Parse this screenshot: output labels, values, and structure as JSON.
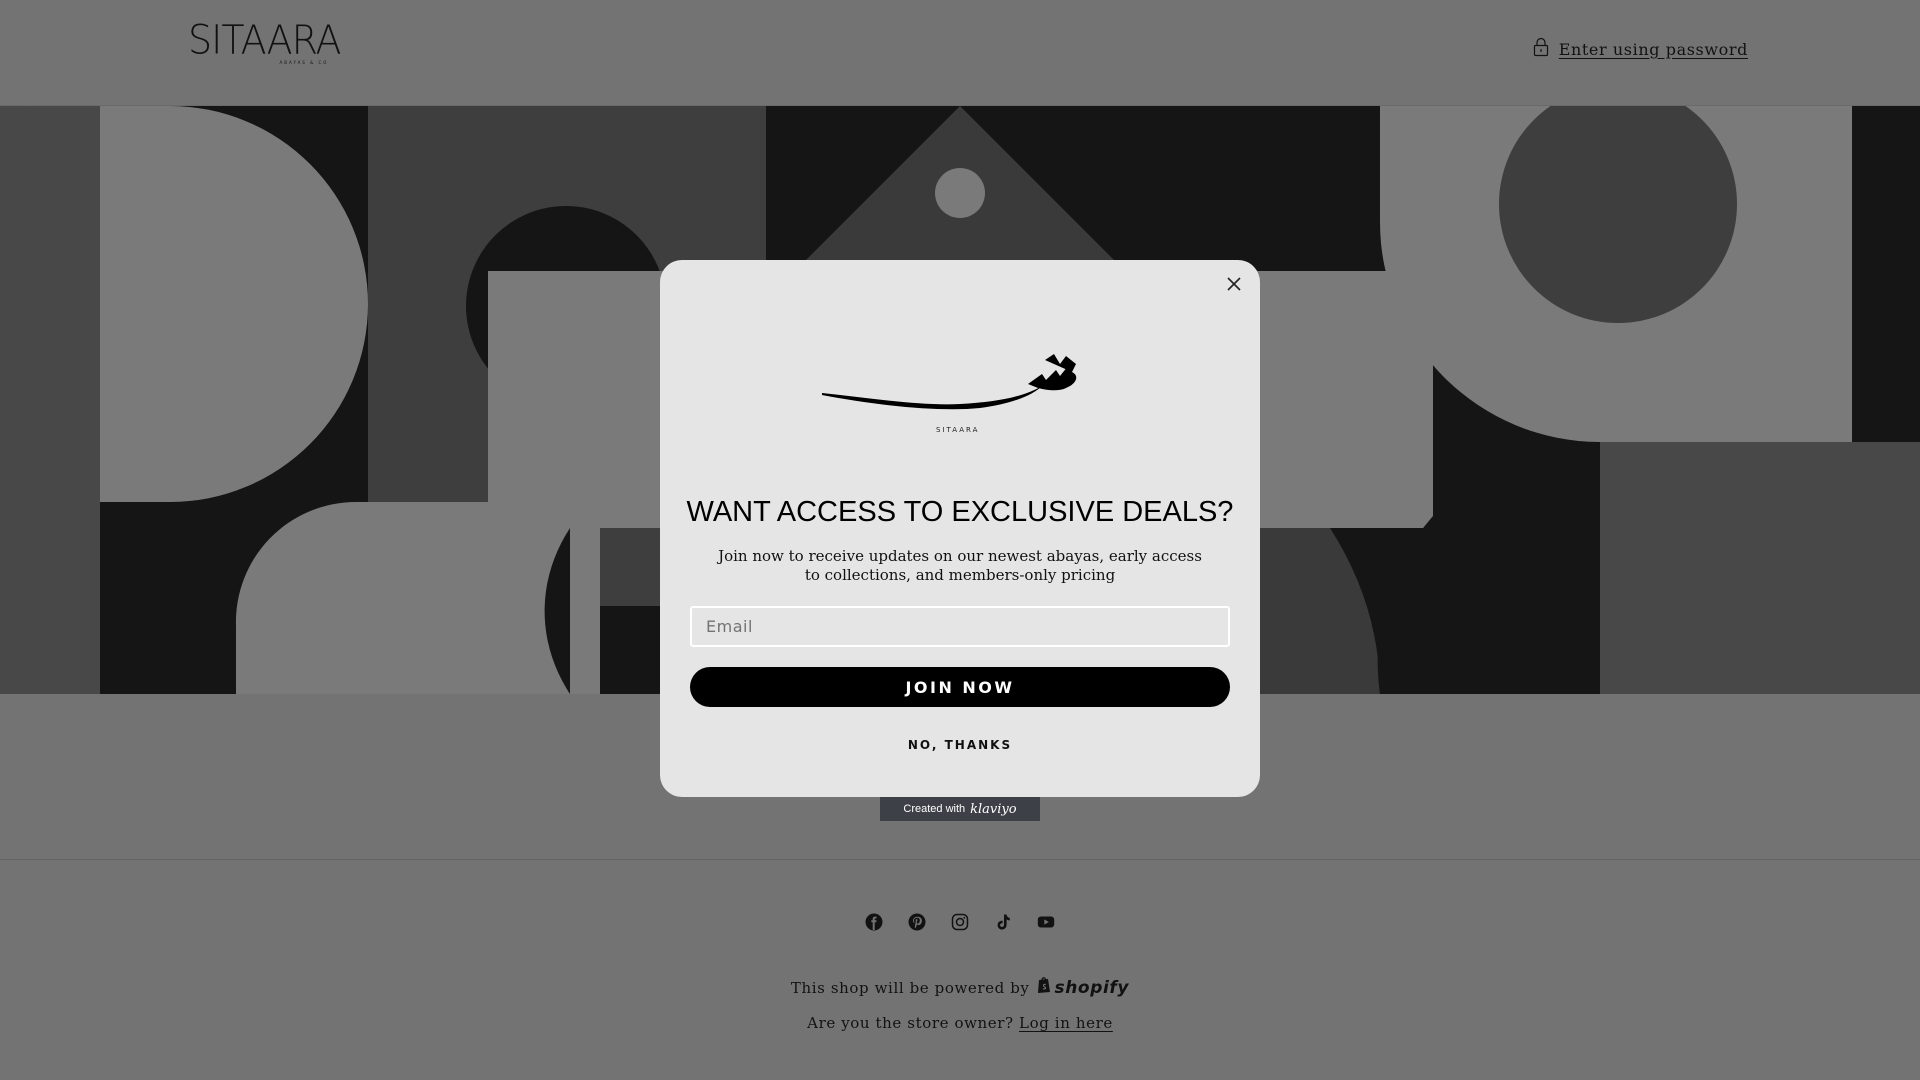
{
  "header": {
    "logo_text": "SITAARA",
    "logo_subtext": "ABAYAS & CO",
    "enter_password_label": "Enter using password"
  },
  "popup": {
    "brand_mark_text": "SITAARA",
    "heading": "WANT ACCESS TO EXCLUSIVE DEALS?",
    "subtext": "Join now to receive updates on our newest abayas, early access to collections, and members-only pricing",
    "email_placeholder": "Email",
    "email_value": "",
    "join_label": "JOIN NOW",
    "decline_label": "NO, THANKS",
    "close_icon": "close-icon"
  },
  "klaviyo_badge": {
    "prefix": "Created with",
    "brand": "klaviyo"
  },
  "footer": {
    "socials": [
      {
        "name": "facebook",
        "icon": "facebook-icon"
      },
      {
        "name": "pinterest",
        "icon": "pinterest-icon"
      },
      {
        "name": "instagram",
        "icon": "instagram-icon"
      },
      {
        "name": "tiktok",
        "icon": "tiktok-icon"
      },
      {
        "name": "youtube",
        "icon": "youtube-icon"
      }
    ],
    "powered_by_text": "This shop will be powered by",
    "powered_by_brand": "shopify",
    "owner_question": "Are you the store owner?",
    "owner_link": "Log in here"
  },
  "colors": {
    "page_background": "#737373",
    "popup_background": "#e5e5e5",
    "button_background": "#000000",
    "klaviyo_badge": "#3d4047"
  }
}
